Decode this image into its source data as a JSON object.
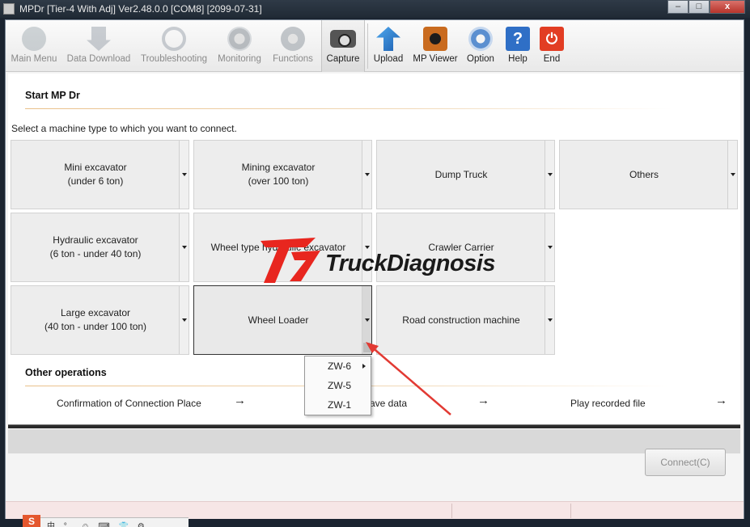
{
  "window": {
    "title": "MPDr [Tier-4 With Adj] Ver2.48.0.0 [COM8] [2099-07-31]",
    "controls": {
      "minimize": "–",
      "maximize": "□",
      "close": "x"
    }
  },
  "toolbar": {
    "items": [
      {
        "label": "Main Menu",
        "icon": "main-menu-icon",
        "enabled": false
      },
      {
        "label": "Data Download",
        "icon": "download-icon",
        "enabled": false
      },
      {
        "label": "Troubleshooting",
        "icon": "stethoscope-icon",
        "enabled": false
      },
      {
        "label": "Monitoring",
        "icon": "gauge-icon",
        "enabled": false
      },
      {
        "label": "Functions",
        "icon": "gear-icon",
        "enabled": false
      },
      {
        "label": "Capture",
        "icon": "camera-icon",
        "enabled": true
      },
      {
        "label": "Upload",
        "icon": "upload-icon",
        "enabled": true
      },
      {
        "label": "MP Viewer",
        "icon": "mp-viewer-icon",
        "enabled": true
      },
      {
        "label": "Option",
        "icon": "option-icon",
        "enabled": true
      },
      {
        "label": "Help",
        "icon": "help-icon",
        "glyph": "?",
        "enabled": true
      },
      {
        "label": "End",
        "icon": "power-icon",
        "glyph": "⏻",
        "enabled": true
      }
    ]
  },
  "start": {
    "title": "Start MP Dr",
    "instruction": "Select a machine type to which you want to connect.",
    "machines": [
      {
        "label": "Mini excavator\n(under 6 ton)"
      },
      {
        "label": "Mining excavator\n(over 100 ton)"
      },
      {
        "label": "Dump Truck"
      },
      {
        "label": "Others"
      },
      {
        "label": "Hydraulic excavator\n(6 ton - under 40 ton)"
      },
      {
        "label": "Wheel type hydraulic excavator"
      },
      {
        "label": "Crawler Carrier"
      },
      {
        "label": "Large excavator\n(40 ton - under 100 ton)"
      },
      {
        "label": "Wheel Loader",
        "selected": true
      },
      {
        "label": "Road construction machine"
      }
    ]
  },
  "dropdown": {
    "items": [
      {
        "label": "ZW-6",
        "has_submenu": true
      },
      {
        "label": "ZW-5"
      },
      {
        "label": "ZW-1"
      }
    ]
  },
  "other": {
    "title": "Other operations",
    "items": [
      {
        "label": "Confirmation of Connection Place",
        "arrow": "→"
      },
      {
        "label": "ave data",
        "arrow": "→"
      },
      {
        "label": "Play recorded file",
        "arrow": "→"
      }
    ]
  },
  "buttons": {
    "connect": "Connect(C)"
  },
  "taskbar": {
    "ime_label": "S",
    "tray_text": "中 °, ☺ ⌨ 👕 ⚙"
  },
  "watermark": {
    "text": "TruckDiagnosis"
  },
  "colors": {
    "accent_line": "#e9c08a",
    "watermark_red": "#e8261f",
    "end_red": "#e23d23",
    "help_blue": "#2f6fc6"
  }
}
